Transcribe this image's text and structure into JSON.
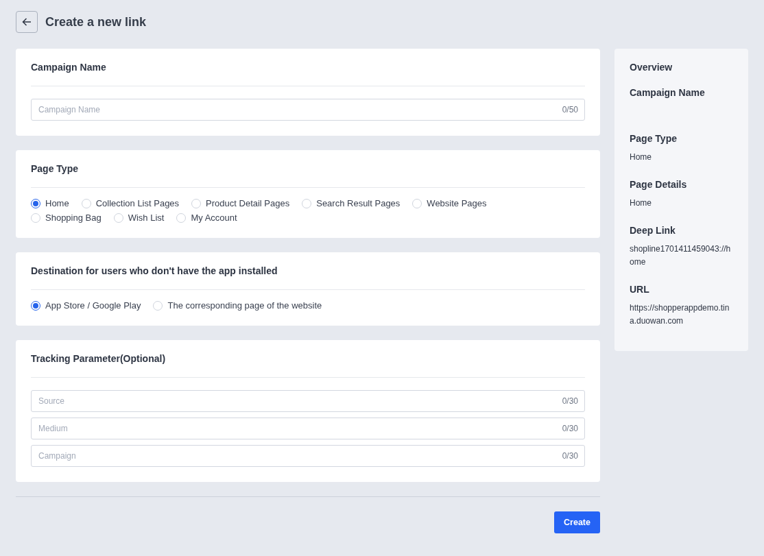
{
  "header": {
    "title": "Create a new link"
  },
  "sections": [
    {
      "kind": "fields",
      "title": "Campaign Name",
      "fields": [
        {
          "placeholder": "Campaign Name",
          "counter": "0/50"
        }
      ]
    },
    {
      "kind": "radios",
      "title": "Page Type",
      "options": [
        {
          "label": "Home",
          "selected": true
        },
        {
          "label": "Collection List Pages",
          "selected": false
        },
        {
          "label": "Product Detail Pages",
          "selected": false
        },
        {
          "label": "Search Result Pages",
          "selected": false
        },
        {
          "label": "Website Pages",
          "selected": false
        },
        {
          "label": "Shopping Bag",
          "selected": false
        },
        {
          "label": "Wish List",
          "selected": false
        },
        {
          "label": "My Account",
          "selected": false
        }
      ]
    },
    {
      "kind": "radios",
      "title": "Destination for users who don't have the app installed",
      "options": [
        {
          "label": "App Store / Google Play",
          "selected": true
        },
        {
          "label": "The corresponding page of the website",
          "selected": false
        }
      ]
    },
    {
      "kind": "fields",
      "title": "Tracking Parameter(Optional)",
      "fields": [
        {
          "placeholder": "Source",
          "counter": "0/30"
        },
        {
          "placeholder": "Medium",
          "counter": "0/30"
        },
        {
          "placeholder": "Campaign",
          "counter": "0/30"
        }
      ]
    }
  ],
  "overview": {
    "title": "Overview",
    "items": [
      {
        "label": "Campaign Name"
      },
      {
        "label": "Page Type",
        "value": "Home"
      },
      {
        "label": "Page Details",
        "value": "Home"
      },
      {
        "label": "Deep Link",
        "value": "shopline1701411459043://home"
      },
      {
        "label": "URL",
        "value": "https://shopperappdemo.tina.duowan.com"
      }
    ]
  },
  "create_button": "Create"
}
